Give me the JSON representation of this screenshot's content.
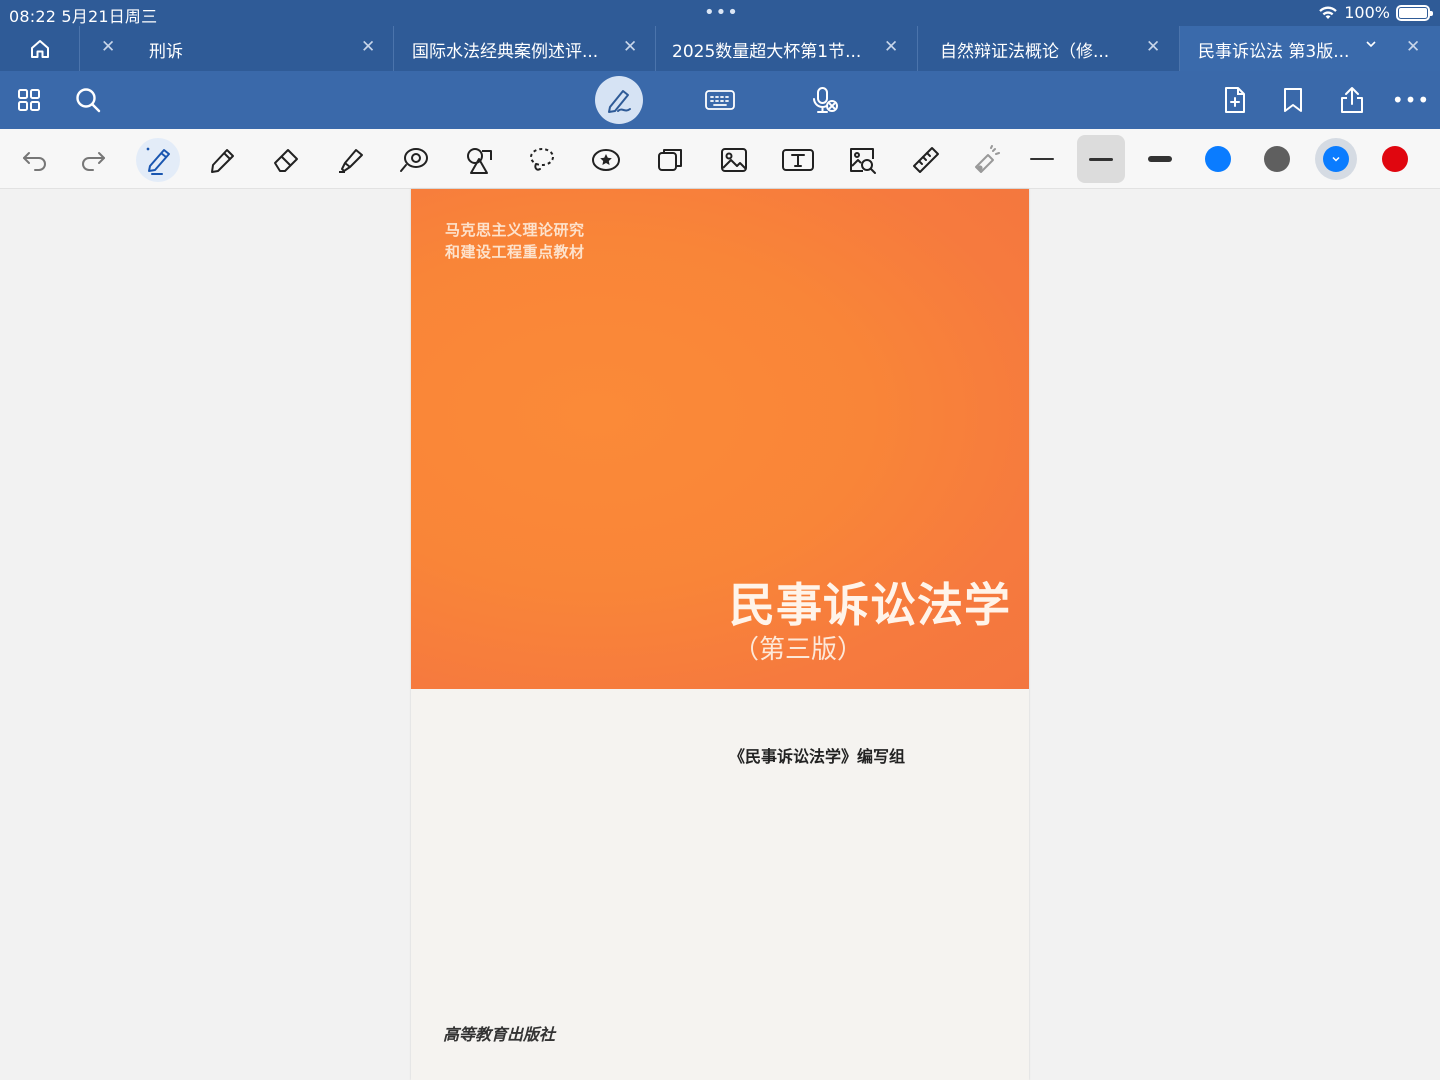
{
  "status_bar": {
    "time_date": "08:22  5月21日周三",
    "dots": "•••",
    "battery": "100%"
  },
  "tabs": [
    {
      "label": "刑诉",
      "active": false
    },
    {
      "label": "国际水法经典案例述评...",
      "active": false
    },
    {
      "label": "2025数量超大杯第1节...",
      "active": false
    },
    {
      "label": "自然辩证法概论（修...",
      "active": false
    },
    {
      "label": "民事诉讼法 第3版...",
      "active": true
    }
  ],
  "toolbar": {
    "left_icons": [
      "grid-icon",
      "search-icon"
    ],
    "center_icons": [
      "pen-mode-icon",
      "keyboard-icon",
      "microphone-icon"
    ],
    "right_icons": [
      "add-page-icon",
      "bookmark-icon",
      "share-icon",
      "more-icon"
    ],
    "more_label": "•••"
  },
  "tools": {
    "items": [
      "undo",
      "redo",
      "ballpoint-pen",
      "pencil",
      "eraser",
      "highlighter",
      "lasso-search",
      "shapes",
      "lasso",
      "sticker",
      "elements",
      "image",
      "text",
      "image-search",
      "ruler",
      "laser-pointer"
    ],
    "selected": "ballpoint-pen",
    "widths": [
      "thin",
      "medium",
      "thick"
    ],
    "selected_width": "medium",
    "colors": [
      "#0a7cff",
      "#5f5f5f",
      "#0a7cff",
      "#e0060f"
    ],
    "selected_color_index": 2
  },
  "document": {
    "series": [
      "马克思主义理论研究",
      "和建设工程重点教材"
    ],
    "title": "民事诉讼法学",
    "edition": "（第三版）",
    "authors": "《民事诉讼法学》编写组",
    "publisher": "高等教育出版社",
    "cover_color": "#f98538"
  }
}
